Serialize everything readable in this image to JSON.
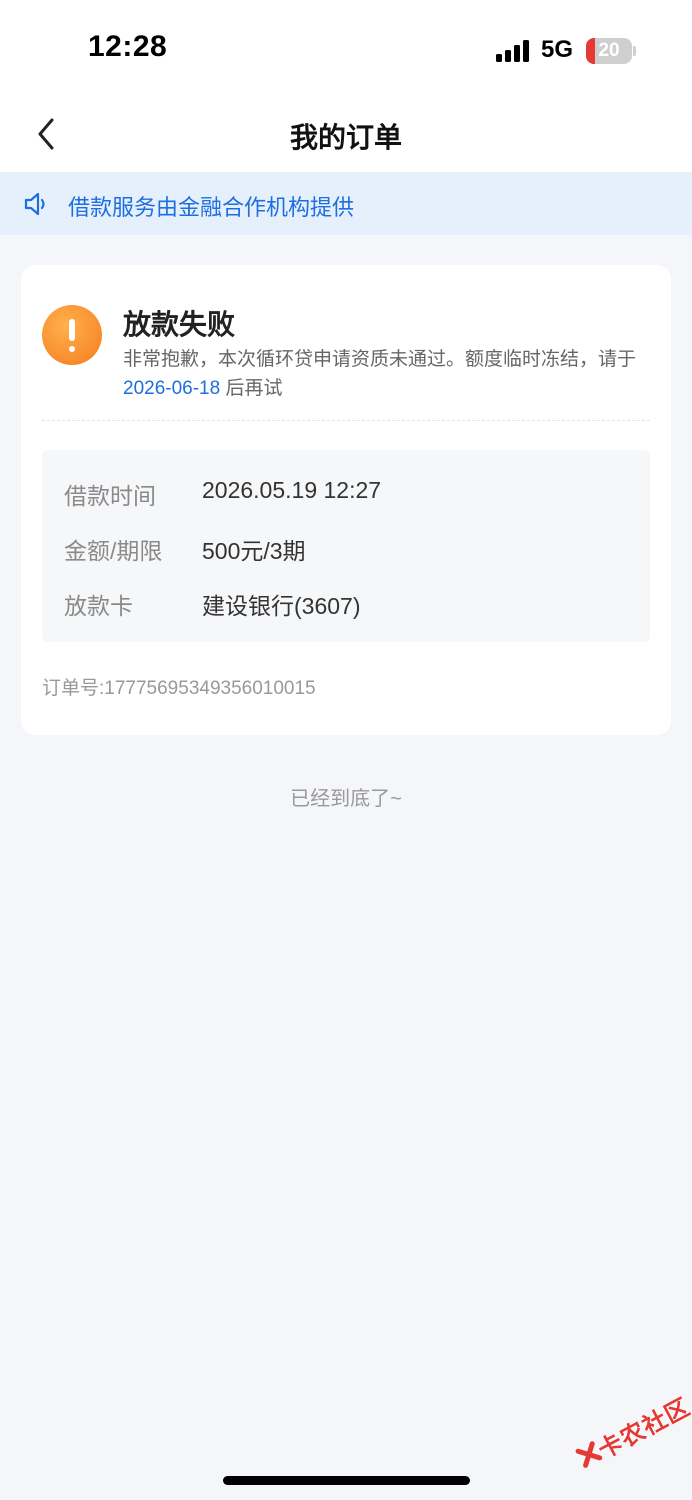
{
  "status_bar": {
    "time": "12:28",
    "network": "5G",
    "battery": "20",
    "battery_level": 0.2
  },
  "nav": {
    "title": "我的订单"
  },
  "notice": {
    "text": "借款服务由金融合作机构提供"
  },
  "order": {
    "status_title": "放款失败",
    "status_desc_prefix": "非常抱歉，本次循环贷申请资质未通过。额度临时冻结，请于 ",
    "retry_date": "2026-06-18",
    "status_desc_suffix": " 后再试",
    "details": [
      {
        "label": "借款时间",
        "value": "2026.05.19 12:27"
      },
      {
        "label": "金额/期限",
        "value": "500元/3期"
      },
      {
        "label": "放款卡",
        "value": "建设银行(3607)"
      }
    ],
    "order_number": "订单号:1777569534935601001​5"
  },
  "footer": {
    "end_text": "已经到底了~"
  },
  "watermark": {
    "text": "卡农社区"
  },
  "colors": {
    "accent": "#1d6fe0",
    "warning": "#f57c1f",
    "background": "#f5f6f9",
    "notice_bg": "#e6f0fd"
  }
}
